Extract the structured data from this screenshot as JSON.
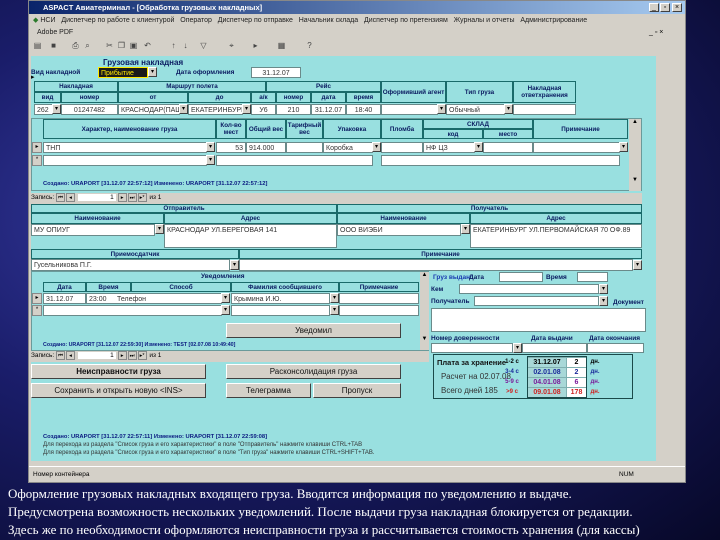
{
  "window": {
    "title": "ASPACT Авиатерминал - [Обработка грузовых накладных]",
    "adobe": "Adobe PDF"
  },
  "menu": [
    "НСИ",
    "Диспетчер по работе с клиентурой",
    "Оператор",
    "Диспетчер по отправке",
    "Начальник склада",
    "Диспетчер по претензиям",
    "Журналы и отчеты",
    "Администрирование"
  ],
  "form": {
    "title": "Грузовая накладная",
    "kind_label": "Вид накладной",
    "kind_value": "Прибытие",
    "date_label": "Дата оформления",
    "date_value": "31.12.07",
    "header": {
      "nakl": "Накладная",
      "route": "Маршрут полета",
      "flight": "Рейс",
      "agent": "Оформивший агент",
      "cargo_type": "Тип груза",
      "storage": "Накладная ответхранения",
      "sub": [
        "вид",
        "номер",
        "от",
        "до",
        "а/к",
        "номер",
        "дата",
        "время"
      ]
    },
    "row": {
      "vid": "262",
      "nomer": "01247482",
      "from": "КРАСНОДАР(ПАШ",
      "to": "ЕКАТЕРИНБУРГ(",
      "ak": "У6",
      "flight_no": "210",
      "date": "31.12.07",
      "time": "18:40",
      "agent": "",
      "cargo_type": "Обычный",
      "storage": ""
    },
    "cargo_cols": [
      "Характер, наименование груза",
      "Кол-во мест",
      "Общий вес",
      "Тарифный вес",
      "Упаковка",
      "Пломба",
      "СКЛАД",
      "код",
      "место",
      "Примечание"
    ],
    "cargo_rows": [
      {
        "name": "ТНП",
        "places": "53",
        "weight": "914.000",
        "tariff": "",
        "pack": "Коробка",
        "seal": "",
        "code": "НФ ЦЗ",
        "place": "",
        "note": ""
      }
    ],
    "cargo_created": "Создано: URAPORT [31.12.07 22:57:12] Изменено: URAPORT [31.12.07 22:57:12]",
    "nav1": {
      "label": "Запись:",
      "current": "1",
      "total": "из 1"
    },
    "sender": {
      "title": "Отправитель",
      "name_h": "Наименование",
      "addr_h": "Адрес",
      "name": "МУ ОПИУГ",
      "addr": "КРАСНОДАР УЛ.БЕРЕГОВАЯ 141"
    },
    "receiver": {
      "title": "Получатель",
      "name_h": "Наименование",
      "addr_h": "Адрес",
      "name": "ООО ВИЭБИ",
      "addr": "ЕКАТЕРИНБУРГ УЛ.ПЕРВОМАЙСКАЯ 70 ОФ.89"
    },
    "clerk": {
      "label": "Приемосдатчик",
      "value": "Гусельникова П.Г."
    },
    "note": {
      "label": "Примечание",
      "value": ""
    },
    "notif": {
      "title": "Уведомления",
      "cols": [
        "Дата",
        "Время",
        "Способ",
        "Фамилия сообщившего",
        "Примечание"
      ],
      "row": {
        "date": "31.12.07",
        "time": "23:00",
        "method": "Телефон",
        "who": "Крымина И.Ю.",
        "note": ""
      },
      "button": "Уведомил",
      "created": "Создано: URAPORT [31.12.07 22:59:30] Изменено: TEST [02.07.08 10:49:40]",
      "nav": {
        "label": "Запись:",
        "current": "1",
        "total": "из 1"
      }
    },
    "buttons": {
      "defects": "Неисправности груза",
      "deconsol": "Расконсолидация груза",
      "save_new": "Сохранить и открыть новую <INS>",
      "telegram": "Телеграмма",
      "pass": "Пропуск"
    },
    "issue": {
      "issued": "Груз выдан:",
      "date": "Дата",
      "time": "Время",
      "by": "Кем",
      "recipient": "Получатель",
      "document": "Документ",
      "proxy": "Номер доверенности",
      "issue_date": "Дата выдачи",
      "end_date": "Дата окончания"
    },
    "storage_fee": {
      "title": "Плата за хранение",
      "calc": "Расчет на 02.07.08",
      "total": "Всего дней 185",
      "rows": [
        {
          "range": "1-2 с",
          "date": "31.12.07",
          "days": "2",
          "unit": "дн.",
          "color": "#000000"
        },
        {
          "range": "3-4 с",
          "date": "02.01.08",
          "days": "2",
          "unit": "дн.",
          "color": "#1a2a9a"
        },
        {
          "range": "5-9 с",
          "date": "04.01.08",
          "days": "6",
          "unit": "дн.",
          "color": "#7a1a9a"
        },
        {
          "range": ">9 с",
          "date": "09.01.08",
          "days": "178",
          "unit": "дн.",
          "color": "#d02020"
        }
      ]
    },
    "footer_created": "Создано: URAPORT [31.12.07 22:57:11] Изменено: URAPORT [31.12.07 22:59:08]",
    "hint1": "Для перехода из раздела \"Список груза и его характеристики\" в поле \"Отправитель\" нажмите клавиши CTRL+TAB",
    "hint2": "Для перехода из раздела \"Список груза и его характеристики\" в поле \"Тип груза\" нажмите клавиши CTRL+SHIFT+TAB."
  },
  "status": {
    "left": "Номер контейнера",
    "num": "NUM"
  },
  "caption": [
    "Оформление грузовых накладных входящего груза.  Вводится информация по уведомлению и выдаче.",
    "Предусмотрена возможность нескольких уведомлений. После выдачи груза накладная блокируется от редакции.",
    "Здесь же по необходимости оформляются неисправности груза и рассчитывается стоимость хранения (для кассы)"
  ]
}
